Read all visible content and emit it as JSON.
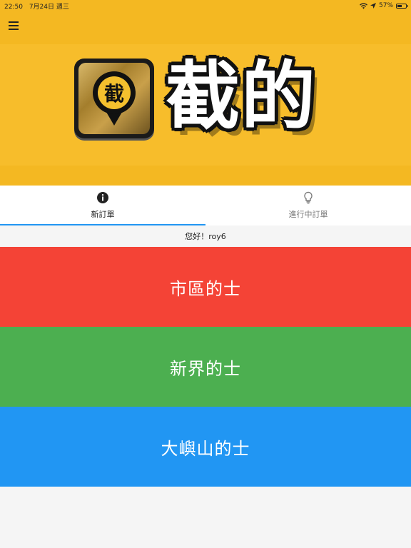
{
  "status_bar": {
    "time": "22:50",
    "date": "7月24日 週三",
    "battery": "57%",
    "battery_level": 0.57
  },
  "brand": {
    "logo_char": "截",
    "title": "截的"
  },
  "tabs": [
    {
      "label": "新訂單",
      "icon": "info-icon",
      "active": true
    },
    {
      "label": "進行中訂單",
      "icon": "lightbulb-icon",
      "active": false
    }
  ],
  "greeting": "您好！roy6",
  "options": [
    {
      "label": "市區的士",
      "color": "#f44336"
    },
    {
      "label": "新界的士",
      "color": "#4caf50"
    },
    {
      "label": "大嶼山的士",
      "color": "#2196f3"
    }
  ],
  "colors": {
    "app_bar": "#f4b822",
    "tab_indicator": "#2196f3"
  }
}
